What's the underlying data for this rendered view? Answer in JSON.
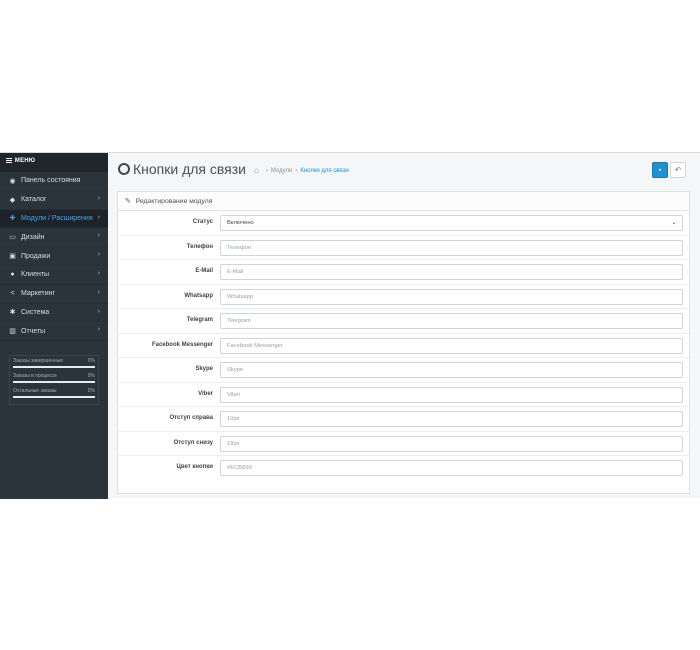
{
  "sidebar": {
    "menu_label": "МЕНЮ",
    "items": [
      {
        "label": "Панель состояния",
        "icon": "dashboard-icon",
        "glyph": "◉",
        "chevron": ""
      },
      {
        "label": "Каталог",
        "icon": "tag-icon",
        "glyph": "◆",
        "chevron": "›"
      },
      {
        "label": "Модули / Расширения",
        "icon": "puzzle-icon",
        "glyph": "✚",
        "chevron": "›",
        "active": true
      },
      {
        "label": "Дизайн",
        "icon": "monitor-icon",
        "glyph": "▭",
        "chevron": "›"
      },
      {
        "label": "Продажи",
        "icon": "cart-icon",
        "glyph": "▣",
        "chevron": "›"
      },
      {
        "label": "Клиенты",
        "icon": "user-icon",
        "glyph": "●",
        "chevron": "›"
      },
      {
        "label": "Маркетинг",
        "icon": "share-icon",
        "glyph": "<",
        "chevron": "›"
      },
      {
        "label": "Система",
        "icon": "gear-icon",
        "glyph": "✱",
        "chevron": "›"
      },
      {
        "label": "Отчеты",
        "icon": "bar-chart-icon",
        "glyph": "▥",
        "chevron": "›"
      }
    ],
    "stats": [
      {
        "label": "Заказы завершенные",
        "percent": "0%",
        "progress": 1
      },
      {
        "label": "Заказы в процессе",
        "percent": "0%",
        "progress": 1
      },
      {
        "label": "Остальные заказы",
        "percent": "0%",
        "progress": 1
      }
    ]
  },
  "header": {
    "title": "Кнопки для связи",
    "breadcrumbs": {
      "home_icon": "⌂",
      "sep": "›",
      "modules": "Модули",
      "current": "Кнопки для связи"
    },
    "save_glyph": "▪",
    "back_glyph": "↶"
  },
  "panel": {
    "heading": "Редактирование модуля",
    "heading_glyph": "✎",
    "status": {
      "label": "Статус",
      "value": "Включено",
      "caret": "⌄"
    },
    "fields": [
      {
        "label": "Телефон",
        "placeholder": "Телефон"
      },
      {
        "label": "E-Mail",
        "placeholder": "E-Mail"
      },
      {
        "label": "Whatsapp",
        "placeholder": "Whatsapp"
      },
      {
        "label": "Telegram",
        "placeholder": "Telegram"
      },
      {
        "label": "Facebook Messenger",
        "placeholder": "Facebook Messenger"
      },
      {
        "label": "Skype",
        "placeholder": "Skype"
      },
      {
        "label": "Viber",
        "placeholder": "Viber"
      },
      {
        "label": "Отступ справа",
        "placeholder": "10px"
      },
      {
        "label": "Отступ снизу",
        "placeholder": "18px"
      },
      {
        "label": "Цвет кнопки",
        "placeholder": "#ECB899"
      }
    ]
  },
  "colors": {
    "accent": "#1e91cf",
    "sidebar": "#2b333b",
    "active_text": "#4aa3df"
  }
}
